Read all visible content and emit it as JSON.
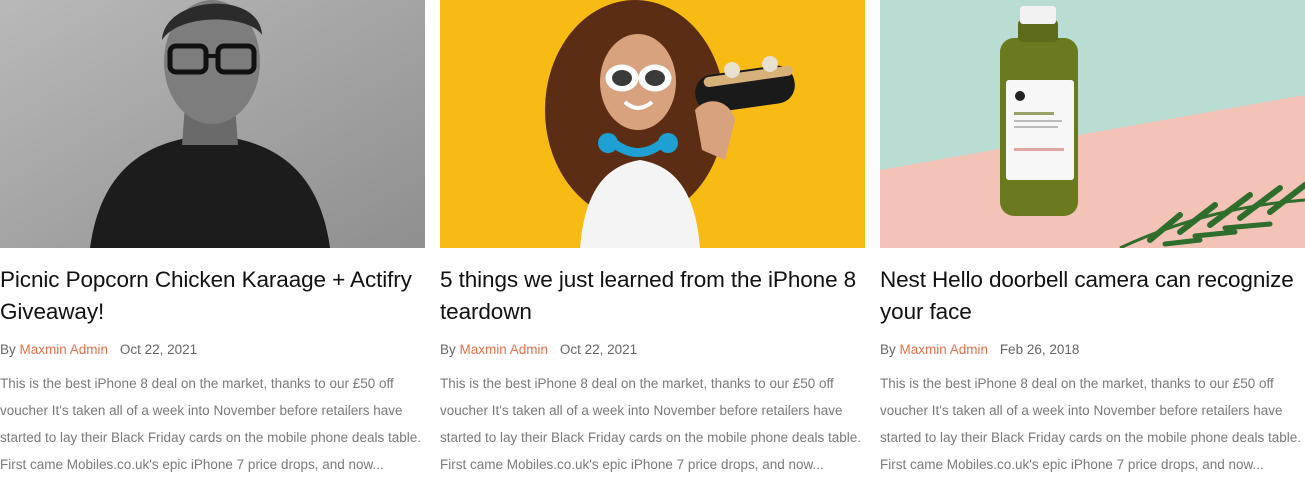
{
  "posts": [
    {
      "title": "Picnic Popcorn Chicken Karaage + Actifry Giveaway!",
      "by": "By",
      "author": "Maxmin Admin",
      "date": "Oct 22, 2021",
      "excerpt": "This is the best iPhone 8 deal on the market, thanks to our £50 off voucher It's taken all of a week into November before retailers have started to lay their Black Friday cards on the mobile phone deals table. First came Mobiles.co.uk's epic iPhone 7 price drops, and now..."
    },
    {
      "title": "5 things we just learned from the iPhone 8 teardown",
      "by": "By",
      "author": "Maxmin Admin",
      "date": "Oct 22, 2021",
      "excerpt": "This is the best iPhone 8 deal on the market, thanks to our £50 off voucher It's taken all of a week into November before retailers have started to lay their Black Friday cards on the mobile phone deals table. First came Mobiles.co.uk's epic iPhone 7 price drops, and now..."
    },
    {
      "title": "Nest Hello doorbell camera can recognize your face",
      "by": "By",
      "author": "Maxmin Admin",
      "date": "Feb 26, 2018",
      "excerpt": "This is the best iPhone 8 deal on the market, thanks to our £50 off voucher It's taken all of a week into November before retailers have started to lay their Black Friday cards on the mobile phone deals table. First came Mobiles.co.uk's epic iPhone 7 price drops, and now..."
    }
  ],
  "colors": {
    "author_link": "#e8704a",
    "title": "#111111",
    "meta": "#666666",
    "excerpt": "#7a7a7a"
  }
}
